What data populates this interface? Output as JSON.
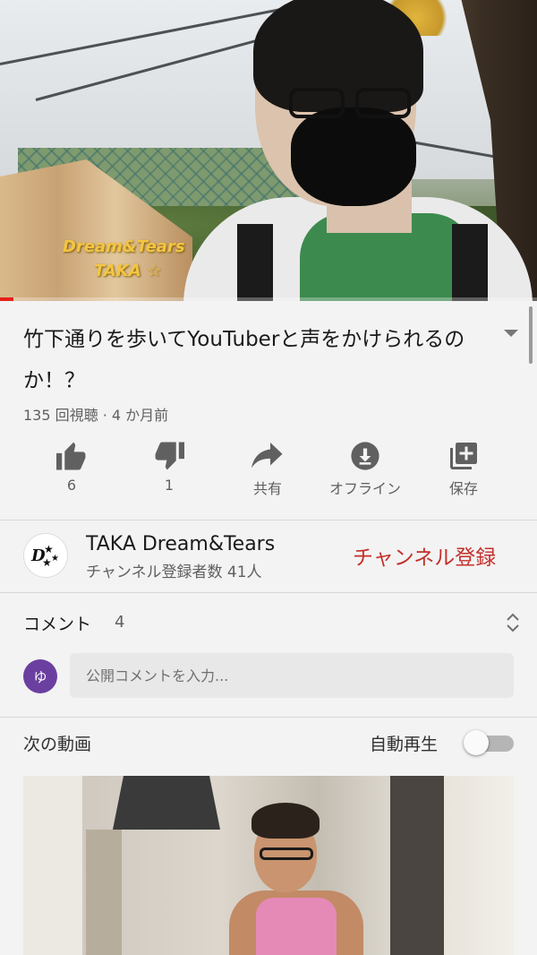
{
  "video": {
    "overlay_line1": "Dream&Tears",
    "overlay_line2": "TAKA ☆",
    "progress_fraction": 0.025
  },
  "info": {
    "title": "竹下通りを歩いてYouTuberと声をかけられるのか！？",
    "meta": "135 回視聴 · 4 か月前",
    "actions": [
      {
        "icon": "thumbs-up-icon",
        "label": "6"
      },
      {
        "icon": "thumbs-down-icon",
        "label": "1"
      },
      {
        "icon": "share-icon",
        "label": "共有"
      },
      {
        "icon": "download-icon",
        "label": "オフライン"
      },
      {
        "icon": "add-to-playlist-icon",
        "label": "保存"
      }
    ]
  },
  "channel": {
    "name": "TAKA Dream&Tears",
    "subscribers": "チャンネル登録者数 41人",
    "subscribe_label": "チャンネル登録",
    "avatar_text": "D★"
  },
  "comments": {
    "title": "コメント",
    "count": "4",
    "user_initial": "ゆ",
    "input_placeholder": "公開コメントを入力..."
  },
  "up_next": {
    "title": "次の動画",
    "autoplay_label": "自動再生",
    "autoplay_on": false
  },
  "colors": {
    "subscribe": "#c4302b",
    "progress": "#e62117",
    "user_avatar": "#6b3fa0"
  }
}
